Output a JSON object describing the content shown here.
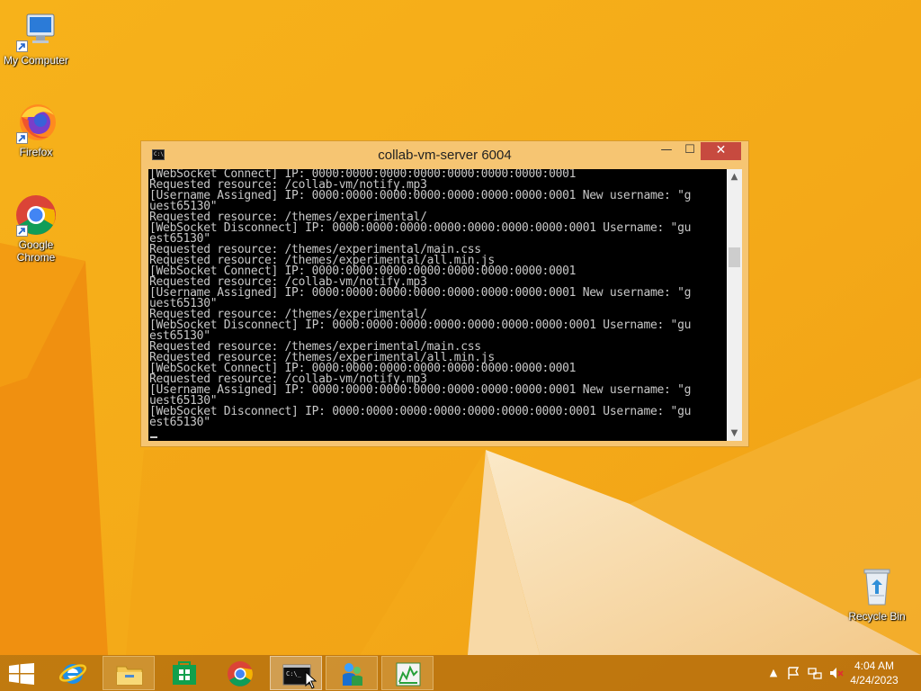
{
  "desktop": {
    "icons": [
      {
        "label": "My Computer"
      },
      {
        "label": "Firefox"
      },
      {
        "label": "Google Chrome"
      },
      {
        "label": "Recycle Bin"
      }
    ]
  },
  "window": {
    "title": "collab-vm-server  6004",
    "console_icon_text": "C:\\",
    "buttons": {
      "minimize": "—",
      "maximize": "☐",
      "close": "✕"
    },
    "console_lines": [
      "[WebSocket Connect] IP: 0000:0000:0000:0000:0000:0000:0000:0001",
      "Requested resource: /collab-vm/notify.mp3",
      "[Username Assigned] IP: 0000:0000:0000:0000:0000:0000:0000:0001 New username: \"g",
      "uest65130\"",
      "Requested resource: /themes/experimental/",
      "[WebSocket Disconnect] IP: 0000:0000:0000:0000:0000:0000:0000:0001 Username: \"gu",
      "est65130\"",
      "Requested resource: /themes/experimental/main.css",
      "Requested resource: /themes/experimental/all.min.js",
      "[WebSocket Connect] IP: 0000:0000:0000:0000:0000:0000:0000:0001",
      "Requested resource: /collab-vm/notify.mp3",
      "[Username Assigned] IP: 0000:0000:0000:0000:0000:0000:0000:0001 New username: \"g",
      "uest65130\"",
      "Requested resource: /themes/experimental/",
      "[WebSocket Disconnect] IP: 0000:0000:0000:0000:0000:0000:0000:0001 Username: \"gu",
      "est65130\"",
      "Requested resource: /themes/experimental/main.css",
      "Requested resource: /themes/experimental/all.min.js",
      "[WebSocket Connect] IP: 0000:0000:0000:0000:0000:0000:0000:0001",
      "Requested resource: /collab-vm/notify.mp3",
      "[Username Assigned] IP: 0000:0000:0000:0000:0000:0000:0000:0001 New username: \"g",
      "uest65130\"",
      "[WebSocket Disconnect] IP: 0000:0000:0000:0000:0000:0000:0000:0001 Username: \"gu",
      "est65130\""
    ]
  },
  "taskbar": {
    "items": [
      {
        "name": "start",
        "icon": "windows-logo-icon"
      },
      {
        "name": "internet-explorer",
        "icon": "ie-icon"
      },
      {
        "name": "file-explorer",
        "icon": "folder-icon"
      },
      {
        "name": "store",
        "icon": "store-icon"
      },
      {
        "name": "chrome",
        "icon": "chrome-icon"
      },
      {
        "name": "console",
        "icon": "console-icon",
        "state": "active"
      },
      {
        "name": "messenger",
        "icon": "people-icon"
      },
      {
        "name": "task-manager",
        "icon": "task-manager-icon"
      }
    ],
    "tray": {
      "icons": [
        "show-hidden-icons",
        "action-center-flag-icon",
        "network-icon",
        "volume-muted-icon"
      ],
      "time": "4:04 AM",
      "date": "4/24/2023"
    }
  },
  "colors": {
    "wallpaper_base": "#f6b21b",
    "console_bg": "#000000",
    "console_text": "#c8c8c8",
    "window_frame": "#f6c572",
    "close_button": "#c74a3f"
  }
}
